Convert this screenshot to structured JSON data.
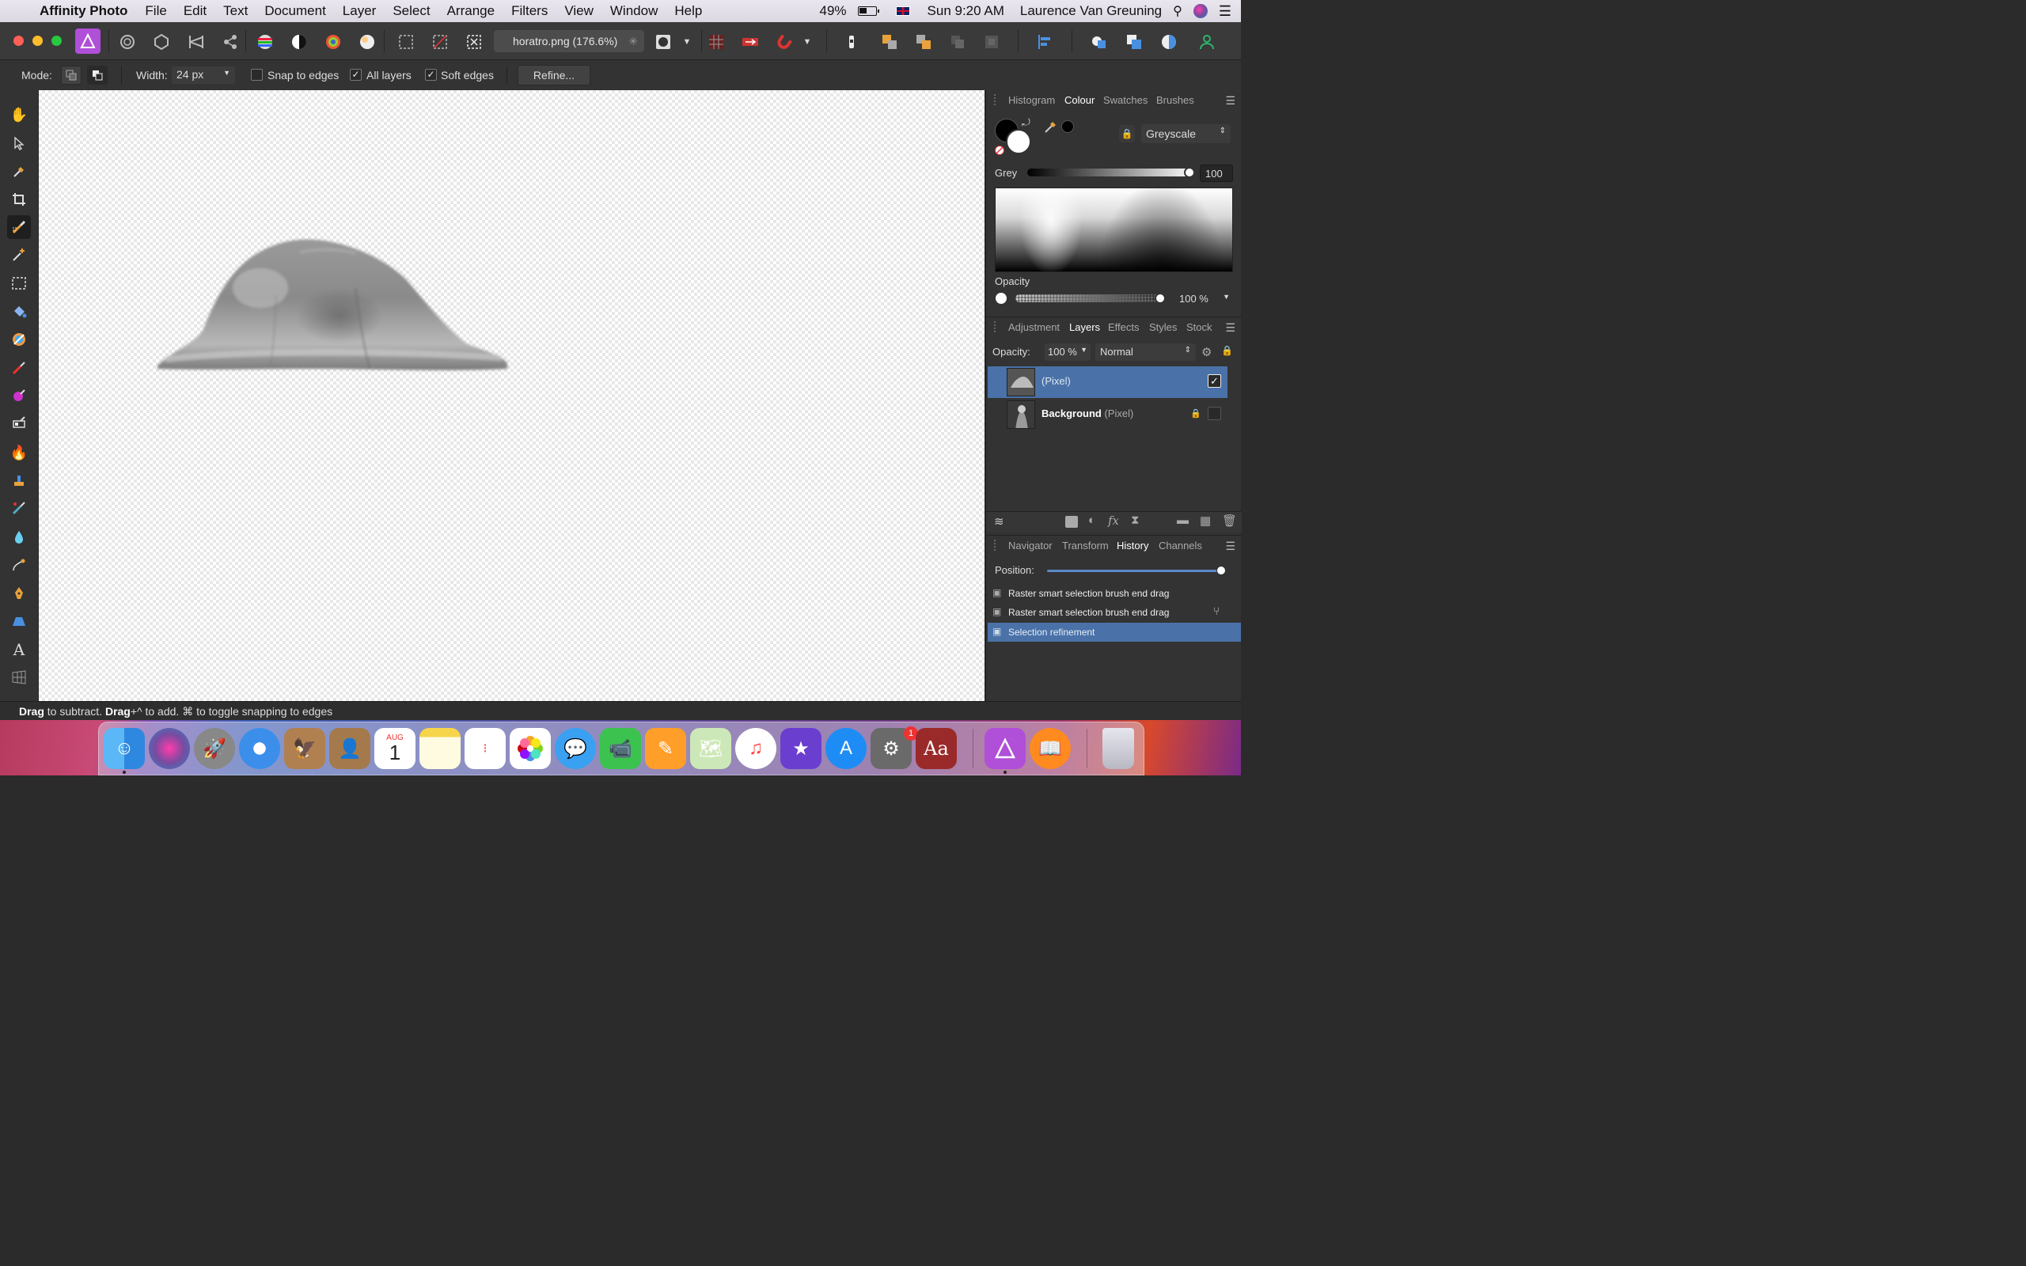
{
  "menubar": {
    "app_name": "Affinity Photo",
    "items": [
      "File",
      "Edit",
      "Text",
      "Document",
      "Layer",
      "Select",
      "Arrange",
      "Filters",
      "View",
      "Window",
      "Help"
    ],
    "battery": "49%",
    "battery_level": 0.49,
    "clock": "Sun 9:20 AM",
    "user": "Laurence Van Greuning"
  },
  "toolbar": {
    "document_tab": "horatro.png (176.6%)",
    "document_close": "✳"
  },
  "context": {
    "mode_label": "Mode:",
    "width_label": "Width:",
    "width_value": "24 px",
    "snap_to_edges": "Snap to edges",
    "snap_checked": false,
    "all_layers": "All layers",
    "all_layers_checked": true,
    "soft_edges": "Soft edges",
    "soft_edges_checked": true,
    "refine_button": "Refine..."
  },
  "colour_panel": {
    "tabs": [
      "Histogram",
      "Colour",
      "Swatches",
      "Brushes"
    ],
    "active_tab": "Colour",
    "model": "Greyscale",
    "grey_label": "Grey",
    "grey_value": "100",
    "grey_level": 1.0,
    "opacity_label": "Opacity",
    "opacity_value": "100 %",
    "opacity_level": 1.0
  },
  "layers_panel": {
    "tabs": [
      "Adjustment",
      "Layers",
      "Effects",
      "Styles",
      "Stock"
    ],
    "active_tab": "Layers",
    "opacity_label": "Opacity:",
    "opacity_value": "100 %",
    "blend_mode": "Normal",
    "layers": [
      {
        "name": "",
        "type": "(Pixel)",
        "selected": true,
        "visible": true,
        "locked": false
      },
      {
        "name": "Background",
        "type": "(Pixel)",
        "selected": false,
        "visible": false,
        "locked": true
      }
    ]
  },
  "history_panel": {
    "tabs": [
      "Navigator",
      "Transform",
      "History",
      "Channels"
    ],
    "active_tab": "History",
    "position_label": "Position:",
    "position_level": 1.0,
    "entries": [
      {
        "label": "Raster smart selection brush end drag",
        "selected": false
      },
      {
        "label": "Raster smart selection brush end drag",
        "selected": false
      },
      {
        "label": "Selection refinement",
        "selected": true
      }
    ]
  },
  "status": {
    "w1": "Drag",
    "t1": " to subtract. ",
    "w2": "Drag",
    "t2": "+^ to add. ⌘ to toggle snapping to edges"
  },
  "dock": {
    "calendar_month": "AUG",
    "calendar_day": "1",
    "prefs_badge": "1",
    "dictionary_text": "Aa"
  },
  "colors": {
    "selection_blue": "#4a72a8",
    "panel_bg": "#333333",
    "accent_green": "#2fb46a"
  }
}
